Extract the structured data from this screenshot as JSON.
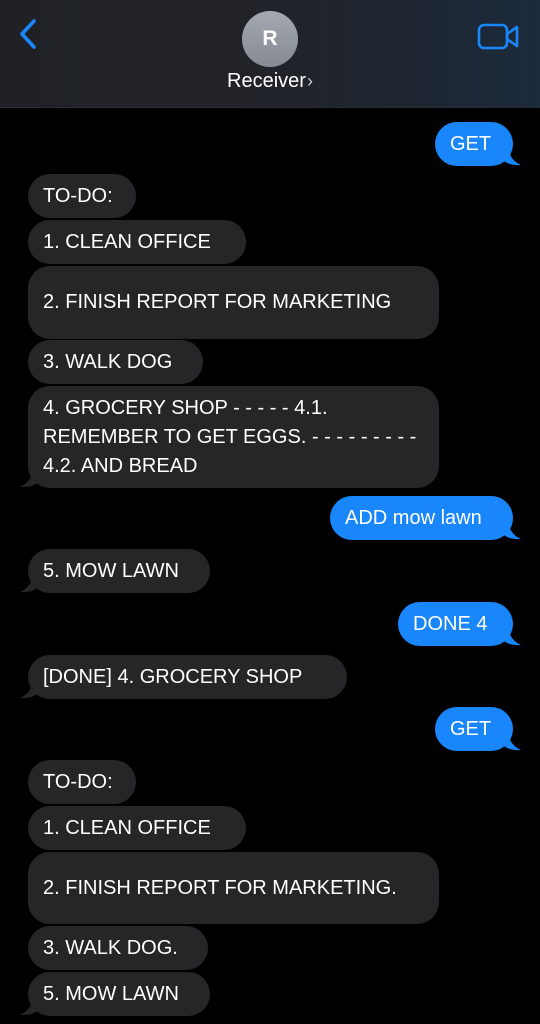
{
  "header": {
    "avatar_initial": "R",
    "contact_name": "Receiver",
    "chevron": "›",
    "back_icon": "chevron-left-icon",
    "video_icon": "video-camera-icon",
    "accent": "#1a86fb"
  },
  "messages": [
    {
      "from": "me",
      "text": "GET"
    },
    {
      "from": "them",
      "text": "TO-DO:"
    },
    {
      "from": "them",
      "text": "1. CLEAN OFFICE"
    },
    {
      "from": "them",
      "text": "2. FINISH REPORT FOR MARKETING"
    },
    {
      "from": "them",
      "text": "3. WALK DOG"
    },
    {
      "from": "them",
      "text": "4. GROCERY SHOP - - - - - 4.1. REMEMBER TO GET EGGS. - - - - - - - - - 4.2. AND BREAD"
    },
    {
      "from": "me",
      "text": "ADD mow lawn"
    },
    {
      "from": "them",
      "text": "5. MOW LAWN"
    },
    {
      "from": "me",
      "text": "DONE 4"
    },
    {
      "from": "them",
      "text": "[DONE] 4. GROCERY SHOP"
    },
    {
      "from": "me",
      "text": "GET"
    },
    {
      "from": "them",
      "text": "TO-DO:"
    },
    {
      "from": "them",
      "text": "1. CLEAN OFFICE"
    },
    {
      "from": "them",
      "text": "2. FINISH REPORT FOR MARKETING."
    },
    {
      "from": "them",
      "text": "3. WALK DOG."
    },
    {
      "from": "them",
      "text": "5. MOW LAWN"
    }
  ],
  "colors": {
    "sent_bubble": "#1a86fb",
    "received_bubble": "#262628",
    "background": "#000000"
  }
}
